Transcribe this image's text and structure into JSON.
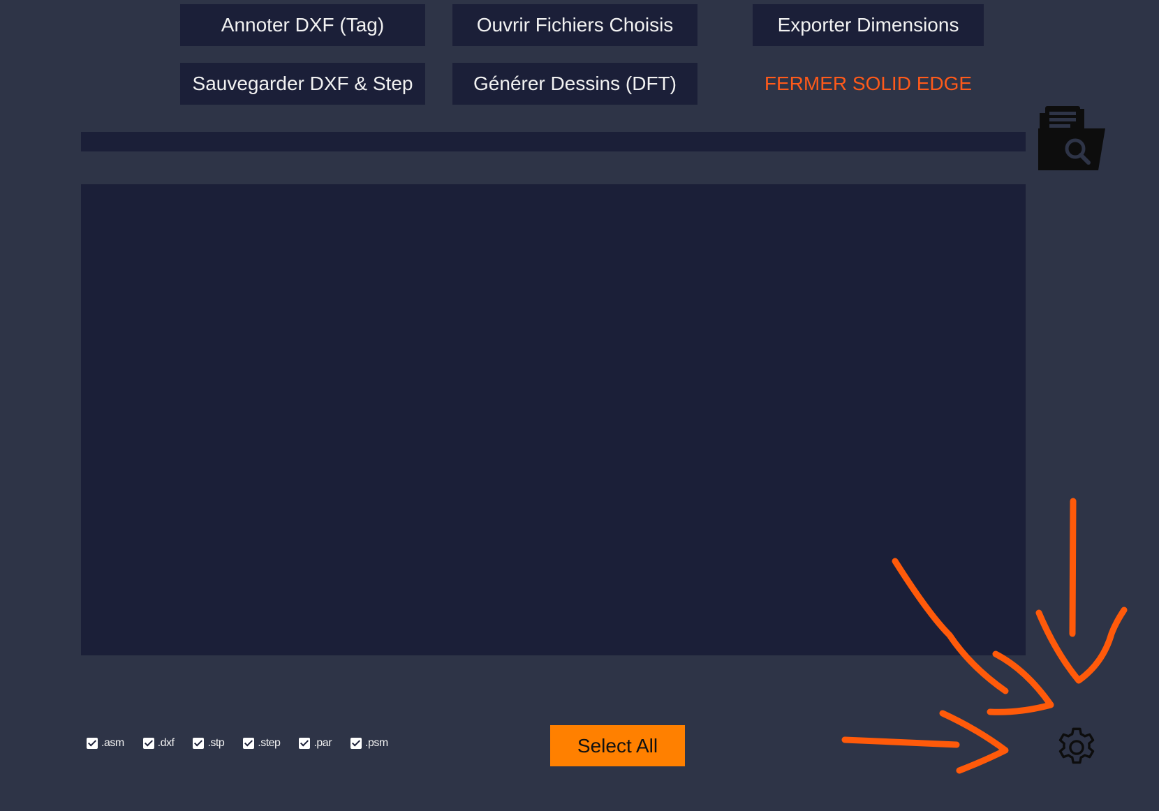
{
  "toolbar": {
    "annotate_label": "Annoter DXF (Tag)",
    "open_label": "Ouvrir Fichiers Choisis",
    "export_label": "Exporter Dimensions",
    "save_label": "Sauvegarder DXF & Step",
    "generate_label": "Générer Dessins (DFT)",
    "close_label": "FERMER SOLID EDGE"
  },
  "path_bar": {
    "value": ""
  },
  "file_list": {
    "items": []
  },
  "filters": [
    {
      "label": ".asm",
      "checked": true
    },
    {
      "label": ".dxf",
      "checked": true
    },
    {
      "label": ".stp",
      "checked": true
    },
    {
      "label": ".step",
      "checked": true
    },
    {
      "label": ".par",
      "checked": true
    },
    {
      "label": ".psm",
      "checked": true
    }
  ],
  "select_all": {
    "label": "Select All"
  },
  "icons": {
    "browse": "folder-search-icon",
    "settings": "gear-icon"
  },
  "colors": {
    "background": "#2e3447",
    "panel": "#1b1f38",
    "text": "#f2f2f2",
    "danger_text": "#ff5a1a",
    "accent": "#ff8000",
    "annotation": "#ff5a0a"
  }
}
